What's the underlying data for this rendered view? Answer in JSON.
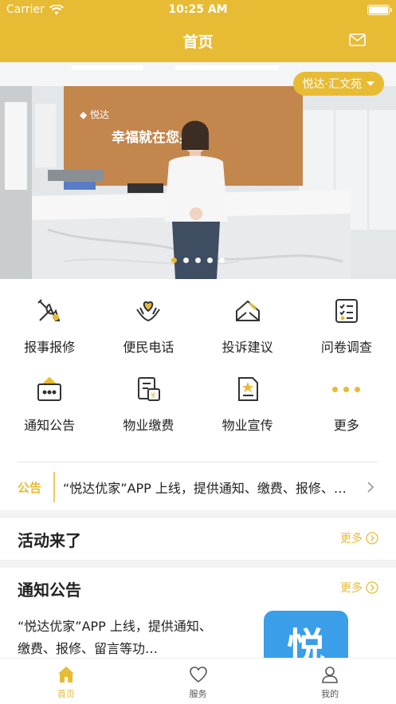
{
  "status_bar": {
    "carrier": "Carrier",
    "time": "10:25 AM"
  },
  "nav": {
    "title": "首页"
  },
  "banner": {
    "community": "悦达·汇文苑",
    "sign_text": "幸福就在您身边",
    "slides": 5,
    "active_slide": 1
  },
  "services": [
    {
      "label": "报事报修",
      "icon": "repair-tools-icon"
    },
    {
      "label": "便民电话",
      "icon": "heart-hands-icon"
    },
    {
      "label": "投诉建议",
      "icon": "envelope-pen-icon"
    },
    {
      "label": "问卷调查",
      "icon": "checklist-icon"
    },
    {
      "label": "通知公告",
      "icon": "notice-board-icon"
    },
    {
      "label": "物业缴费",
      "icon": "payment-bill-icon"
    },
    {
      "label": "物业宣传",
      "icon": "promo-document-icon"
    },
    {
      "label": "更多",
      "icon": "more-dots-icon"
    }
  ],
  "notice": {
    "tag": "公告",
    "text": "“悦达优家”APP 上线，提供通知、缴费、报修、留言等功能"
  },
  "activities": {
    "title": "活动来了",
    "more": "更多"
  },
  "announcements": {
    "title": "通知公告",
    "more": "更多",
    "item_text": "“悦达优家”APP 上线，提供通知、缴费、报修、留言等功…",
    "logo_char": "悦"
  },
  "tabbar": [
    {
      "label": "首页",
      "icon": "home-icon",
      "active": true
    },
    {
      "label": "服务",
      "icon": "heart-icon",
      "active": false
    },
    {
      "label": "我的",
      "icon": "profile-icon",
      "active": false
    }
  ],
  "colors": {
    "accent": "#e8bb35",
    "logo_blue": "#3a9ee8"
  }
}
